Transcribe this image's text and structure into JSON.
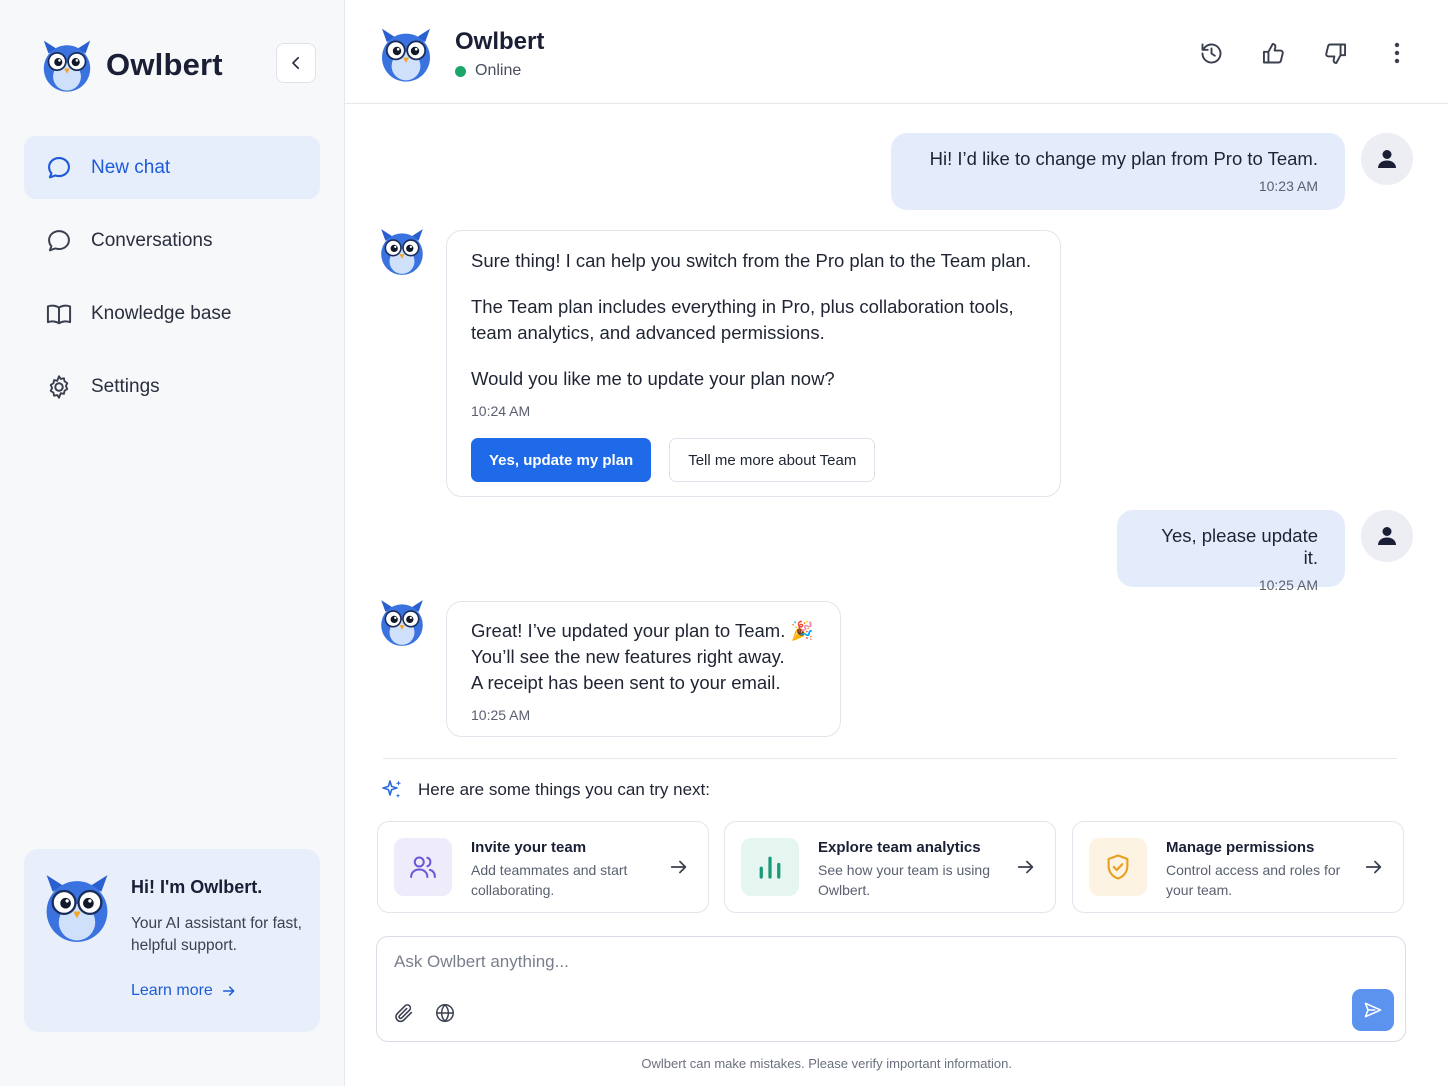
{
  "app": {
    "name": "Owlbert",
    "collapse_icon": "chevron-left-icon"
  },
  "sidebar": {
    "items": [
      {
        "label": "New chat",
        "icon": "chat-bubble-icon",
        "active": true
      },
      {
        "label": "Conversations",
        "icon": "chat-bubble-icon",
        "active": false
      },
      {
        "label": "Knowledge base",
        "icon": "book-icon",
        "active": false
      },
      {
        "label": "Settings",
        "icon": "gear-icon",
        "active": false
      }
    ],
    "promo": {
      "title": "Hi! I'm Owlbert.",
      "text": "Your AI assistant for fast, helpful support.",
      "link": "Learn more"
    }
  },
  "header": {
    "title": "Owlbert",
    "status": "Online",
    "status_color": "#1aa66a",
    "actions": [
      "history-icon",
      "thumbs-up-icon",
      "thumbs-down-icon",
      "more-vertical-icon"
    ]
  },
  "messages": [
    {
      "from": "user",
      "text": "Hi! I’d like to change my plan from Pro to Team.",
      "time": "10:23 AM"
    },
    {
      "from": "bot",
      "paragraphs": [
        "Sure thing! I can help you switch from the Pro plan to the Team plan.",
        "The Team plan includes everything in Pro, plus collaboration tools, team analytics, and advanced permissions.",
        "Would you like me to update your plan now?"
      ],
      "time": "10:24 AM",
      "actions": {
        "primary": "Yes, update my plan",
        "secondary": "Tell me more about Team"
      }
    },
    {
      "from": "user",
      "text": "Yes, please update it.",
      "time": "10:25 AM"
    },
    {
      "from": "bot",
      "lines": [
        "Great! I’ve updated your plan to Team. 🎉",
        "You’ll see the new features right away.",
        "A receipt has been sent to your email."
      ],
      "time": "10:25 AM"
    }
  ],
  "suggestions": {
    "heading": "Here are some things you can try next:",
    "cards": [
      {
        "title": "Invite your team",
        "desc": "Add teammates and start collaborating.",
        "icon": "users-icon",
        "color": "#6b57d6",
        "bg": "#eeebfb"
      },
      {
        "title": "Explore team analytics",
        "desc": "See how your team is using Owlbert.",
        "icon": "bar-chart-icon",
        "color": "#1a9a7a",
        "bg": "#e5f5f0"
      },
      {
        "title": "Manage permissions",
        "desc": "Control access and roles for your team.",
        "icon": "shield-check-icon",
        "color": "#e8a020",
        "bg": "#fdf3e2"
      }
    ]
  },
  "composer": {
    "placeholder": "Ask Owlbert anything...",
    "attach_icon": "paperclip-icon",
    "web_icon": "globe-icon",
    "send_icon": "send-icon"
  },
  "disclaimer": "Owlbert can make mistakes. Please verify important information.",
  "colors": {
    "accent": "#1f6ae8",
    "user_bubble": "#e4ecfb",
    "active_nav": "#e6eefb"
  }
}
